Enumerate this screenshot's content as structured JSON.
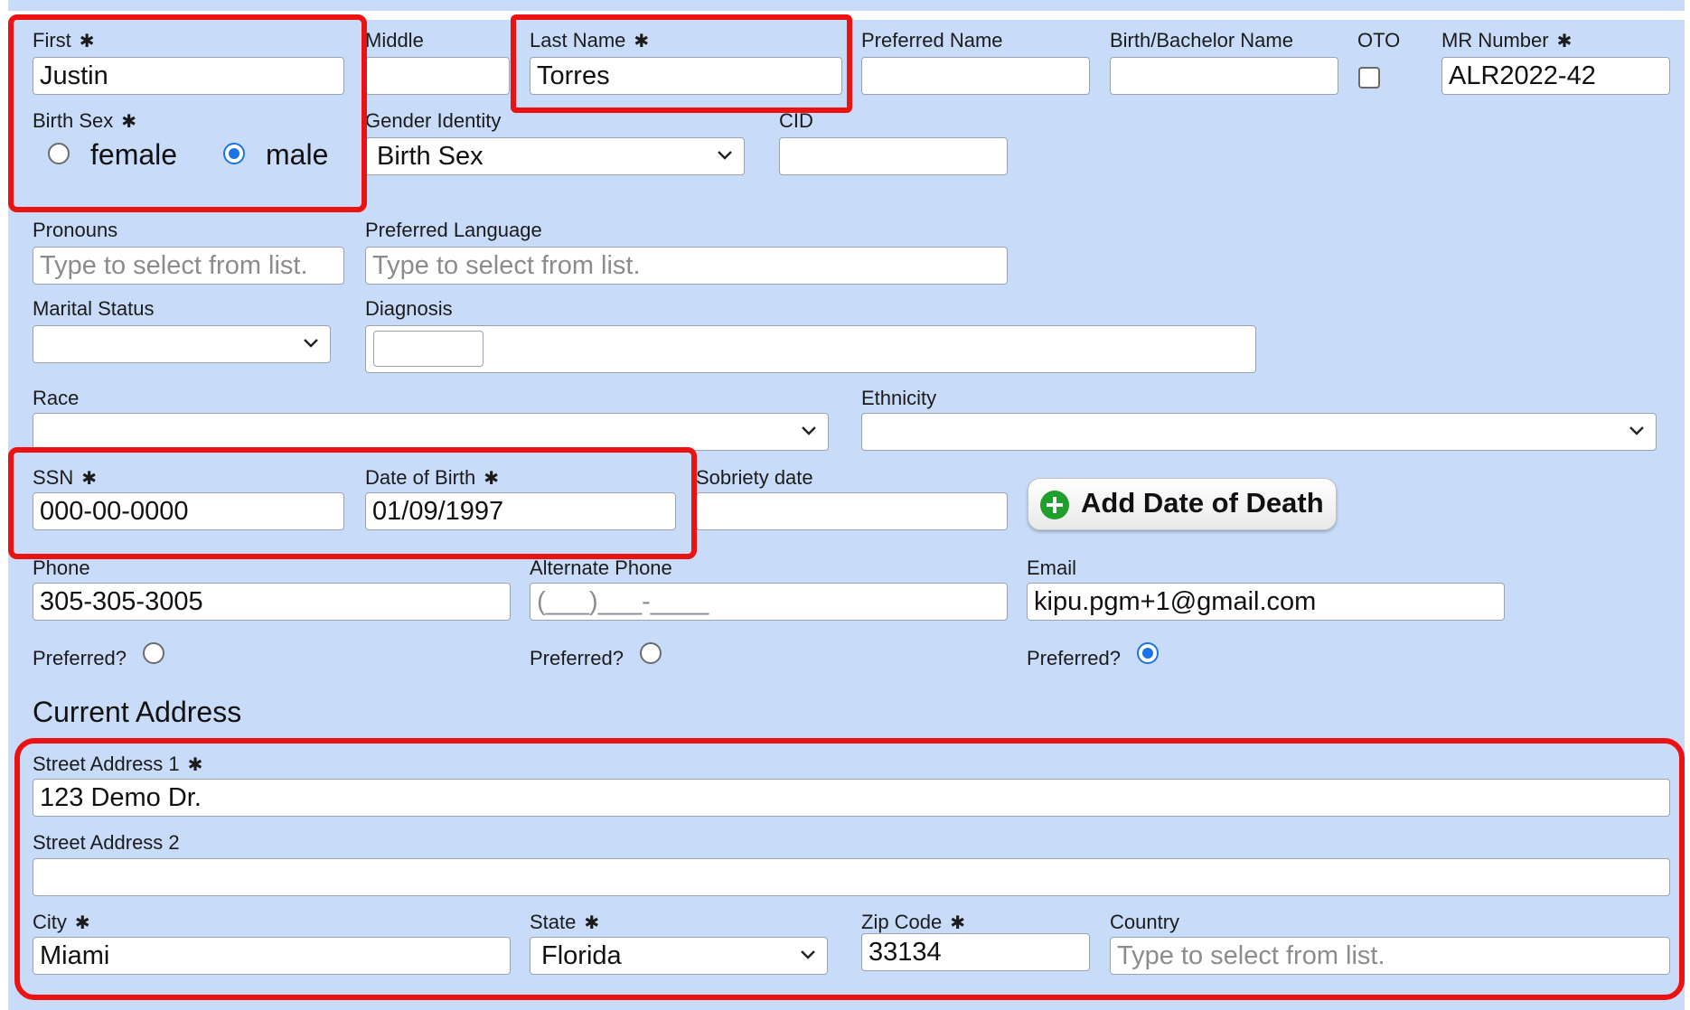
{
  "identity": {
    "first": {
      "label": "First",
      "value": "Justin"
    },
    "middle": {
      "label": "Middle",
      "value": ""
    },
    "last_name": {
      "label": "Last Name",
      "value": "Torres"
    },
    "preferred_name": {
      "label": "Preferred Name",
      "value": ""
    },
    "birth_bachelor_name": {
      "label": "Birth/Bachelor Name",
      "value": ""
    },
    "oto": {
      "label": "OTO",
      "checked": false
    },
    "mr_number": {
      "label": "MR Number",
      "value": "ALR2022-42"
    }
  },
  "birth_sex": {
    "label": "Birth Sex",
    "options": [
      "female",
      "male"
    ],
    "selected": "male"
  },
  "gender_identity": {
    "label": "Gender Identity",
    "value": "Birth Sex"
  },
  "cid": {
    "label": "CID",
    "value": ""
  },
  "pronouns": {
    "label": "Pronouns",
    "placeholder": "Type to select from list."
  },
  "preferred_language": {
    "label": "Preferred Language",
    "placeholder": "Type to select from list."
  },
  "marital_status": {
    "label": "Marital Status",
    "value": ""
  },
  "diagnosis": {
    "label": "Diagnosis",
    "value": ""
  },
  "race": {
    "label": "Race",
    "value": ""
  },
  "ethnicity": {
    "label": "Ethnicity",
    "value": ""
  },
  "ssn": {
    "label": "SSN",
    "value": "000-00-0000"
  },
  "dob": {
    "label": "Date of Birth",
    "value": "01/09/1997"
  },
  "sobriety_date": {
    "label": "Sobriety date",
    "value": ""
  },
  "add_death_button": {
    "label": "Add Date of Death"
  },
  "phone": {
    "label": "Phone",
    "value": "305-305-3005",
    "preferred_label": "Preferred?",
    "preferred": false
  },
  "alternate_phone": {
    "label": "Alternate Phone",
    "mask": "(___)___-____",
    "preferred_label": "Preferred?",
    "preferred": false
  },
  "email": {
    "label": "Email",
    "value": "kipu.pgm+1@gmail.com",
    "preferred_label": "Preferred?",
    "preferred": true
  },
  "address": {
    "heading": "Current Address",
    "street1": {
      "label": "Street Address 1",
      "value": "123 Demo Dr."
    },
    "street2": {
      "label": "Street Address 2",
      "value": ""
    },
    "city": {
      "label": "City",
      "value": "Miami"
    },
    "state": {
      "label": "State",
      "value": "Florida"
    },
    "zip": {
      "label": "Zip Code",
      "value": "33134"
    },
    "country": {
      "label": "Country",
      "placeholder": "Type to select from list."
    }
  },
  "required_mark": "✱",
  "colors": {
    "panel": "#c8dcfa",
    "highlight": "#ee1111",
    "radio_selected": "#1a73e8",
    "plus_icon": "#1f9f2b"
  }
}
